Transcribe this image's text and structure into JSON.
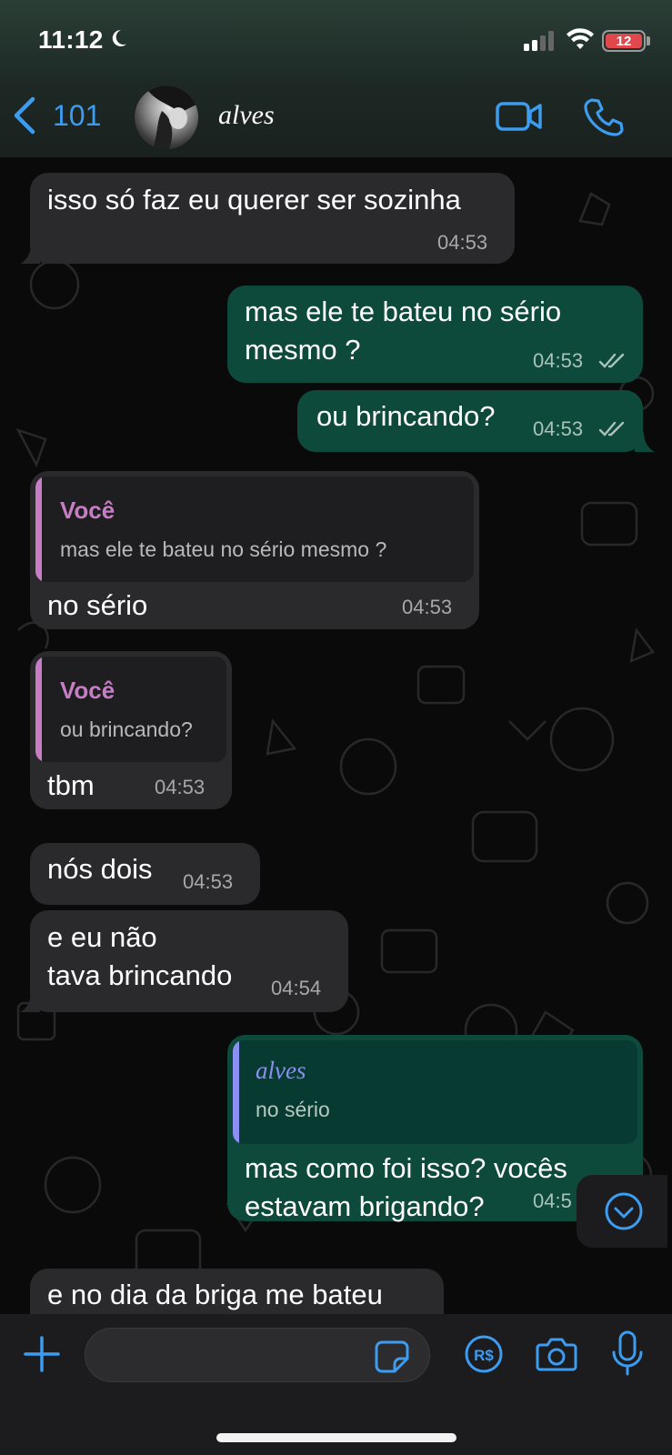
{
  "status_bar": {
    "time": "11:12",
    "battery": "12",
    "moon_icon": "moon-icon",
    "signal_icon": "signal-icon",
    "wifi_icon": "wifi-icon"
  },
  "header": {
    "back_count": "101",
    "contact_name": "alves",
    "back_icon": "chevron-left-icon",
    "video_icon": "video-call-icon",
    "call_icon": "phone-icon"
  },
  "colors": {
    "accent": "#3c9cf0",
    "incoming_bubble": "#2a2a2c",
    "outgoing_bubble": "#0d4a3c",
    "quote_author_in": "#c77dc3",
    "quote_author_out": "#8c8ff2"
  },
  "messages": [
    {
      "dir": "in",
      "text": "isso só faz eu querer ser sozinha",
      "time": "04:53"
    },
    {
      "dir": "out",
      "text": "mas ele te bateu no sério\nmesmo ?",
      "time": "04:53",
      "read": true
    },
    {
      "dir": "out",
      "text": "ou brincando?",
      "time": "04:53",
      "read": true
    },
    {
      "dir": "in",
      "quote_author": "Você",
      "quote_text": "mas ele te bateu no sério mesmo ?",
      "text": "no sério",
      "time": "04:53"
    },
    {
      "dir": "in",
      "quote_author": "Você",
      "quote_text": "ou brincando?",
      "text": "tbm",
      "time": "04:53"
    },
    {
      "dir": "in",
      "text": "nós dois",
      "time": "04:53"
    },
    {
      "dir": "in",
      "text": "e eu não\ntava brincando",
      "time": "04:54"
    },
    {
      "dir": "out",
      "quote_author": "alves",
      "quote_text": "no sério",
      "text": "mas como foi isso? vocês\nestavam brigando?",
      "time": "04:5"
    },
    {
      "dir": "in",
      "text": "e no dia da briga me bateu",
      "time": ""
    }
  ],
  "input": {
    "placeholder": "",
    "plus_icon": "plus-icon",
    "sticker_icon": "sticker-icon",
    "pix_icon": "pix-payment-icon",
    "camera_icon": "camera-icon",
    "mic_icon": "microphone-icon",
    "pix_label": "R$"
  },
  "scroll_down_icon": "chevron-down-circle-icon"
}
